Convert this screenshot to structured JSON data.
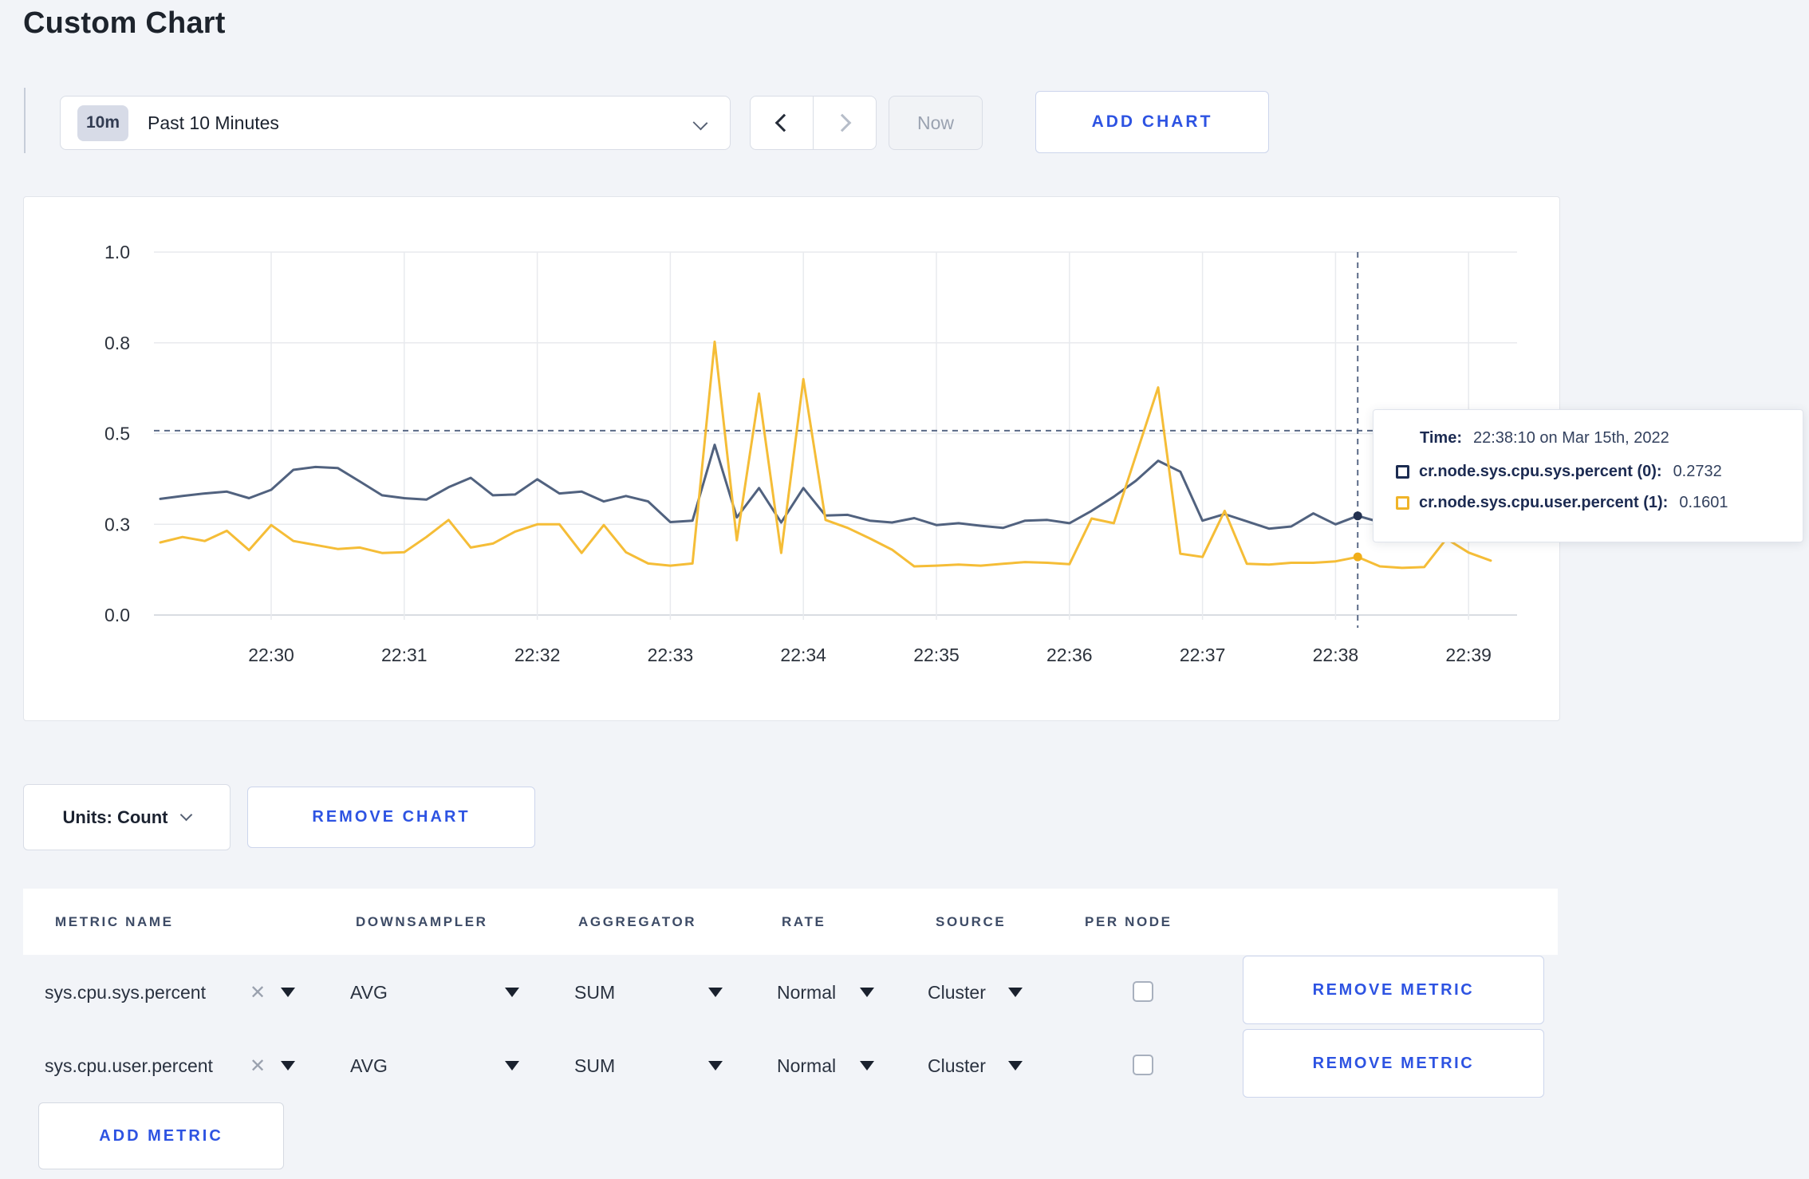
{
  "page": {
    "title": "Custom Chart"
  },
  "toolbar": {
    "time_window": {
      "badge": "10m",
      "label": "Past 10 Minutes"
    },
    "now_label": "Now",
    "add_chart_label": "ADD CHART"
  },
  "chart_controls": {
    "units_label": "Units: Count",
    "remove_chart_label": "REMOVE CHART"
  },
  "tooltip": {
    "time_label": "Time:",
    "time_value": "22:38:10 on Mar 15th, 2022",
    "rows": [
      {
        "label": "cr.node.sys.cpu.sys.percent (0):",
        "value": "0.2732",
        "swatch_color": "#1c2c51"
      },
      {
        "label": "cr.node.sys.cpu.user.percent (1):",
        "value": "0.1601",
        "swatch_color": "#f0b429"
      }
    ]
  },
  "chart_data": {
    "type": "line",
    "title": "",
    "xlabel": "",
    "ylabel": "",
    "grid": true,
    "legend": "none (hover tooltip only)",
    "x_axis": {
      "tick_labels": [
        "22:30",
        "22:31",
        "22:32",
        "22:33",
        "22:34",
        "22:35",
        "22:36",
        "22:37",
        "22:38",
        "22:39"
      ],
      "start_time": "22:29:10",
      "start_offset_minutes": -0.8333,
      "interval_seconds": 10
    },
    "y_axis": {
      "range": [
        0,
        1
      ],
      "tick_values": [
        0,
        0.25,
        0.5,
        0.75,
        1.0
      ],
      "tick_labels": [
        "0.0",
        "0.3",
        "0.5",
        "0.8",
        "1.0"
      ]
    },
    "crosshair": {
      "time": "22:38:10",
      "minutes_from_2230": 8.1667,
      "hline_value": 0.508,
      "points": [
        0.2732,
        0.1601
      ],
      "dot_colors": [
        "#233150",
        "#f0ae19"
      ],
      "dash_color": "#5a6a87"
    },
    "series": [
      {
        "name": "cr.node.sys.cpu.sys.percent",
        "color": "#51627f",
        "values": [
          0.32,
          0.328,
          0.335,
          0.34,
          0.322,
          0.345,
          0.4,
          0.408,
          0.405,
          0.368,
          0.33,
          0.322,
          0.318,
          0.352,
          0.378,
          0.33,
          0.332,
          0.374,
          0.335,
          0.34,
          0.313,
          0.328,
          0.313,
          0.256,
          0.26,
          0.469,
          0.269,
          0.35,
          0.255,
          0.35,
          0.274,
          0.276,
          0.26,
          0.255,
          0.267,
          0.248,
          0.253,
          0.246,
          0.24,
          0.26,
          0.262,
          0.253,
          0.287,
          0.326,
          0.37,
          0.425,
          0.395,
          0.26,
          0.278,
          0.258,
          0.238,
          0.244,
          0.28,
          0.25,
          0.2732,
          0.256,
          0.285,
          0.3,
          0.295,
          0.3,
          0.305
        ]
      },
      {
        "name": "cr.node.sys.cpu.user.percent",
        "color": "#f5bd37",
        "values": [
          0.2,
          0.215,
          0.204,
          0.232,
          0.179,
          0.248,
          0.204,
          0.193,
          0.182,
          0.186,
          0.171,
          0.173,
          0.215,
          0.262,
          0.186,
          0.197,
          0.23,
          0.25,
          0.25,
          0.171,
          0.248,
          0.173,
          0.142,
          0.136,
          0.142,
          0.753,
          0.206,
          0.61,
          0.171,
          0.65,
          0.262,
          0.24,
          0.211,
          0.18,
          0.134,
          0.136,
          0.139,
          0.136,
          0.141,
          0.146,
          0.144,
          0.14,
          0.266,
          0.253,
          0.44,
          0.627,
          0.169,
          0.16,
          0.287,
          0.141,
          0.139,
          0.144,
          0.144,
          0.148,
          0.1601,
          0.134,
          0.13,
          0.132,
          0.21,
          0.172,
          0.15
        ]
      }
    ]
  },
  "metrics_table": {
    "headers": [
      "METRIC NAME",
      "DOWNSAMPLER",
      "AGGREGATOR",
      "RATE",
      "SOURCE",
      "PER NODE"
    ],
    "rows": [
      {
        "metric": "sys.cpu.sys.percent",
        "downsampler": "AVG",
        "aggregator": "SUM",
        "rate": "Normal",
        "source": "Cluster",
        "per_node_checked": false,
        "remove_label": "REMOVE METRIC"
      },
      {
        "metric": "sys.cpu.user.percent",
        "downsampler": "AVG",
        "aggregator": "SUM",
        "rate": "Normal",
        "source": "Cluster",
        "per_node_checked": false,
        "remove_label": "REMOVE METRIC"
      }
    ],
    "add_metric_label": "ADD METRIC"
  }
}
